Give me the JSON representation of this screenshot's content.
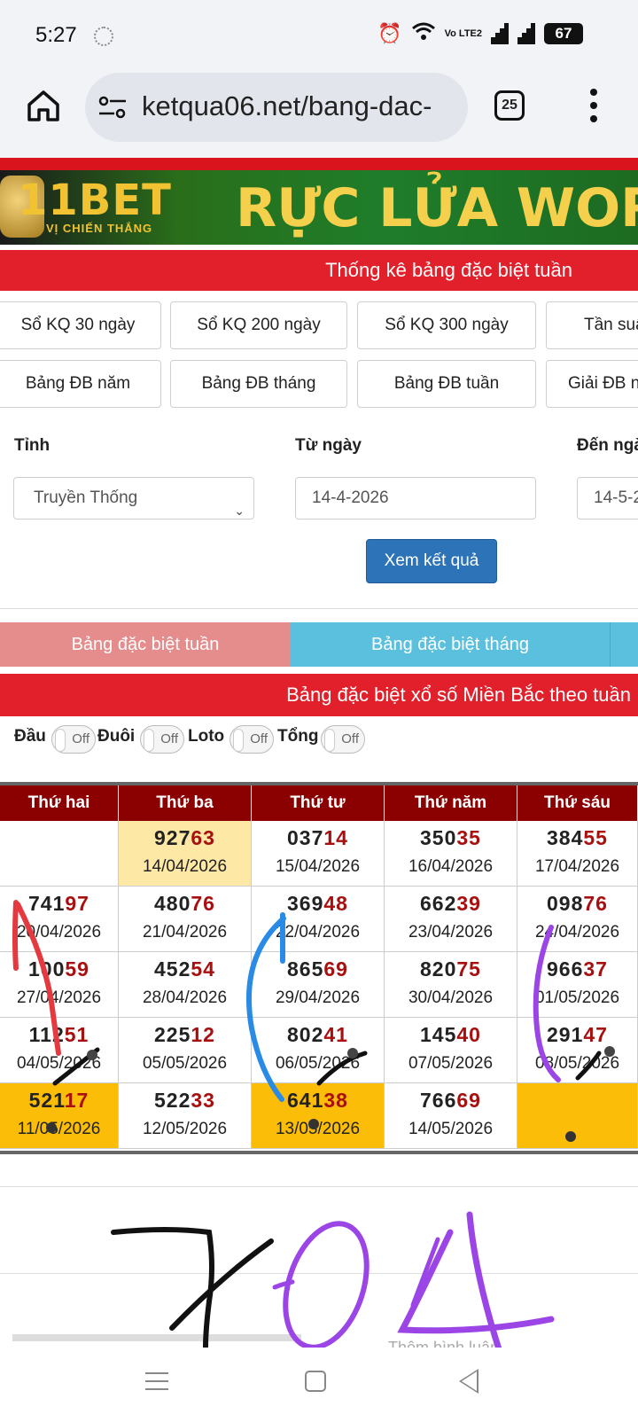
{
  "status_bar": {
    "time": "5:27",
    "network_label": "Vo LTE2",
    "battery": "67"
  },
  "browser": {
    "url": "ketqua06.net/bang-dac-",
    "tab_count": "25"
  },
  "banner": {
    "logo": "11BET",
    "tagline": "VỊ CHIẾN THẮNG",
    "slogan": "RỰC LỬA WORL"
  },
  "section_title": "Thống kê bảng đặc biệt tuần",
  "nav_buttons_row1": [
    "Sổ KQ 30 ngày",
    "Sổ KQ 200 ngày",
    "Sổ KQ 300 ngày",
    "Tần suấ"
  ],
  "nav_buttons_row2": [
    "Bảng ĐB năm",
    "Bảng ĐB tháng",
    "Bảng ĐB tuần",
    "Giải ĐB n"
  ],
  "form": {
    "province_label": "Tỉnh",
    "province_value": "Truyền Thống",
    "from_label": "Từ ngày",
    "from_value": "14-4-2026",
    "to_label": "Đến ngà",
    "to_value": "14-5-2",
    "submit_label": "Xem kết quả"
  },
  "tabs": {
    "week": "Bảng đặc biệt tuần",
    "month": "Bảng đặc biệt tháng"
  },
  "table_title": "Bảng đặc biệt xổ số Miền Bắc theo tuần",
  "toggles": [
    {
      "label": "Đầu",
      "state": "Off"
    },
    {
      "label": "Đuôi",
      "state": "Off"
    },
    {
      "label": "Loto",
      "state": "Off"
    },
    {
      "label": "Tổng",
      "state": "Off"
    }
  ],
  "table": {
    "headers": [
      "Thứ hai",
      "Thứ ba",
      "Thứ tư",
      "Thứ năm",
      "Thứ sáu"
    ],
    "rows": [
      [
        {
          "head": "",
          "tail": "",
          "date": ""
        },
        {
          "head": "927",
          "tail": "63",
          "date": "14/04/2026"
        },
        {
          "head": "037",
          "tail": "14",
          "date": "15/04/2026"
        },
        {
          "head": "350",
          "tail": "35",
          "date": "16/04/2026"
        },
        {
          "head": "384",
          "tail": "55",
          "date": "17/04/2026"
        }
      ],
      [
        {
          "head": "741",
          "tail": "97",
          "date": "20/04/2026"
        },
        {
          "head": "480",
          "tail": "76",
          "date": "21/04/2026"
        },
        {
          "head": "369",
          "tail": "48",
          "date": "22/04/2026"
        },
        {
          "head": "662",
          "tail": "39",
          "date": "23/04/2026"
        },
        {
          "head": "098",
          "tail": "76",
          "date": "24/04/2026"
        }
      ],
      [
        {
          "head": "100",
          "tail": "59",
          "date": "27/04/2026"
        },
        {
          "head": "452",
          "tail": "54",
          "date": "28/04/2026"
        },
        {
          "head": "865",
          "tail": "69",
          "date": "29/04/2026"
        },
        {
          "head": "820",
          "tail": "75",
          "date": "30/04/2026"
        },
        {
          "head": "966",
          "tail": "37",
          "date": "01/05/2026"
        }
      ],
      [
        {
          "head": "112",
          "tail": "51",
          "date": "04/05/2026"
        },
        {
          "head": "225",
          "tail": "12",
          "date": "05/05/2026"
        },
        {
          "head": "802",
          "tail": "41",
          "date": "06/05/2026"
        },
        {
          "head": "145",
          "tail": "40",
          "date": "07/05/2026"
        },
        {
          "head": "291",
          "tail": "47",
          "date": "08/05/2026"
        }
      ],
      [
        {
          "head": "521",
          "tail": "17",
          "date": "11/05/2026"
        },
        {
          "head": "522",
          "tail": "33",
          "date": "12/05/2026"
        },
        {
          "head": "641",
          "tail": "38",
          "date": "13/05/2026"
        },
        {
          "head": "766",
          "tail": "69",
          "date": "14/05/2026"
        },
        {
          "head": "",
          "tail": "",
          "date": ""
        }
      ]
    ]
  },
  "comment_link": "Thêm bình luận",
  "colors": {
    "primary_red": "#e2202b",
    "header_dark_red": "#8b0000",
    "tail_red": "#a80f0f",
    "highlight_yellow": "#fde8a5",
    "highlight_orange": "#fbbd07",
    "tab_week": "#e58c8c",
    "tab_month": "#5bc0de",
    "submit_blue": "#2c73b8"
  }
}
